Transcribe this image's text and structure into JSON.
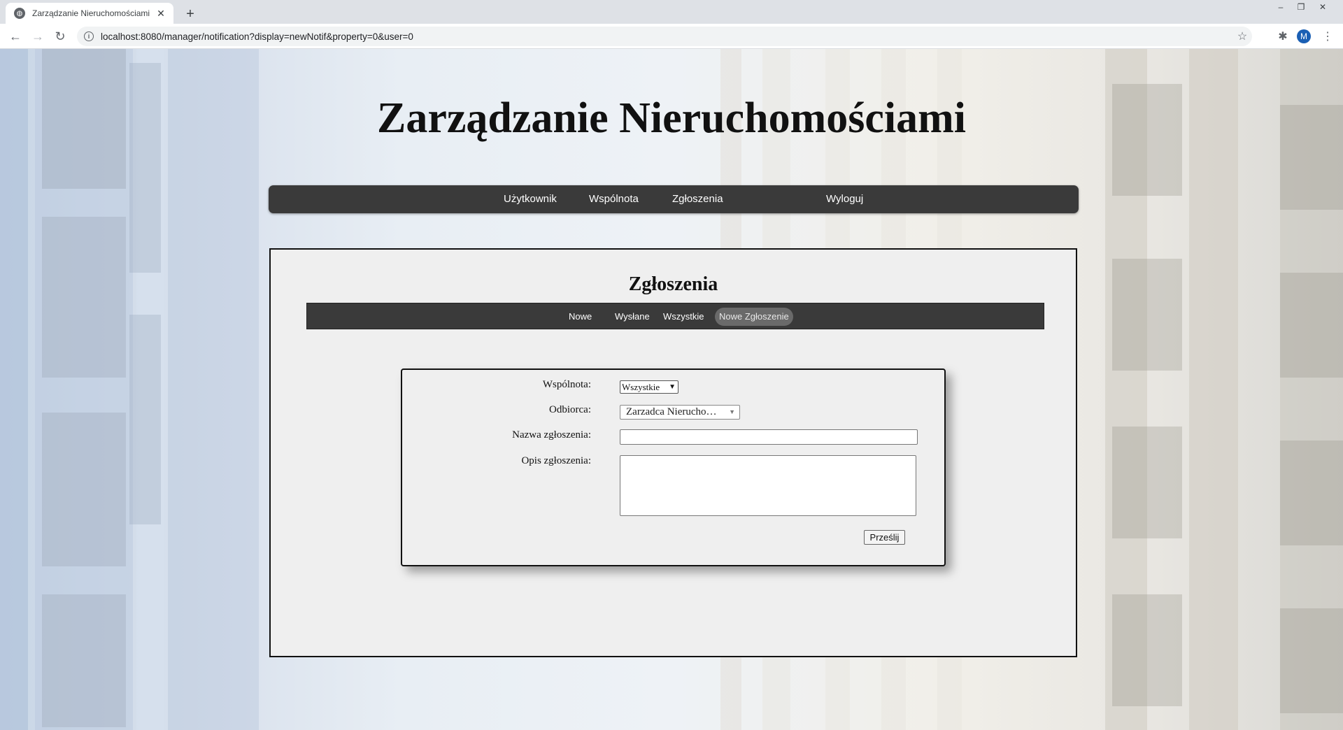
{
  "browser": {
    "tab_title": "Zarządzanie Nieruchomościami",
    "url": "localhost:8080/manager/notification?display=newNotif&property=0&user=0",
    "profile_initial": "M"
  },
  "page": {
    "site_title": "Zarządzanie Nieruchomościami",
    "main_nav": {
      "user": "Użytkownik",
      "community": "Wspólnota",
      "notifications": "Zgłoszenia",
      "logout": "Wyloguj"
    },
    "panel_title": "Zgłoszenia",
    "sub_nav": {
      "new": "Nowe",
      "sent": "Wysłane",
      "all": "Wszystkie",
      "new_notification": "Nowe Zgłoszenie",
      "active": "Nowe Zgłoszenie"
    },
    "form": {
      "community_label": "Wspólnota:",
      "community_value": "Wszystkie",
      "recipient_label": "Odbiorca:",
      "recipient_value": "Zarzadca Nierucho…",
      "name_label": "Nazwa zgłoszenia:",
      "name_value": "",
      "description_label": "Opis zgłoszenia:",
      "description_value": "",
      "submit_label": "Prześlij"
    }
  },
  "colors": {
    "nav_bg": "#3a3a3a",
    "panel_bg": "#efefef",
    "active_pill": "#6a6a6a"
  }
}
